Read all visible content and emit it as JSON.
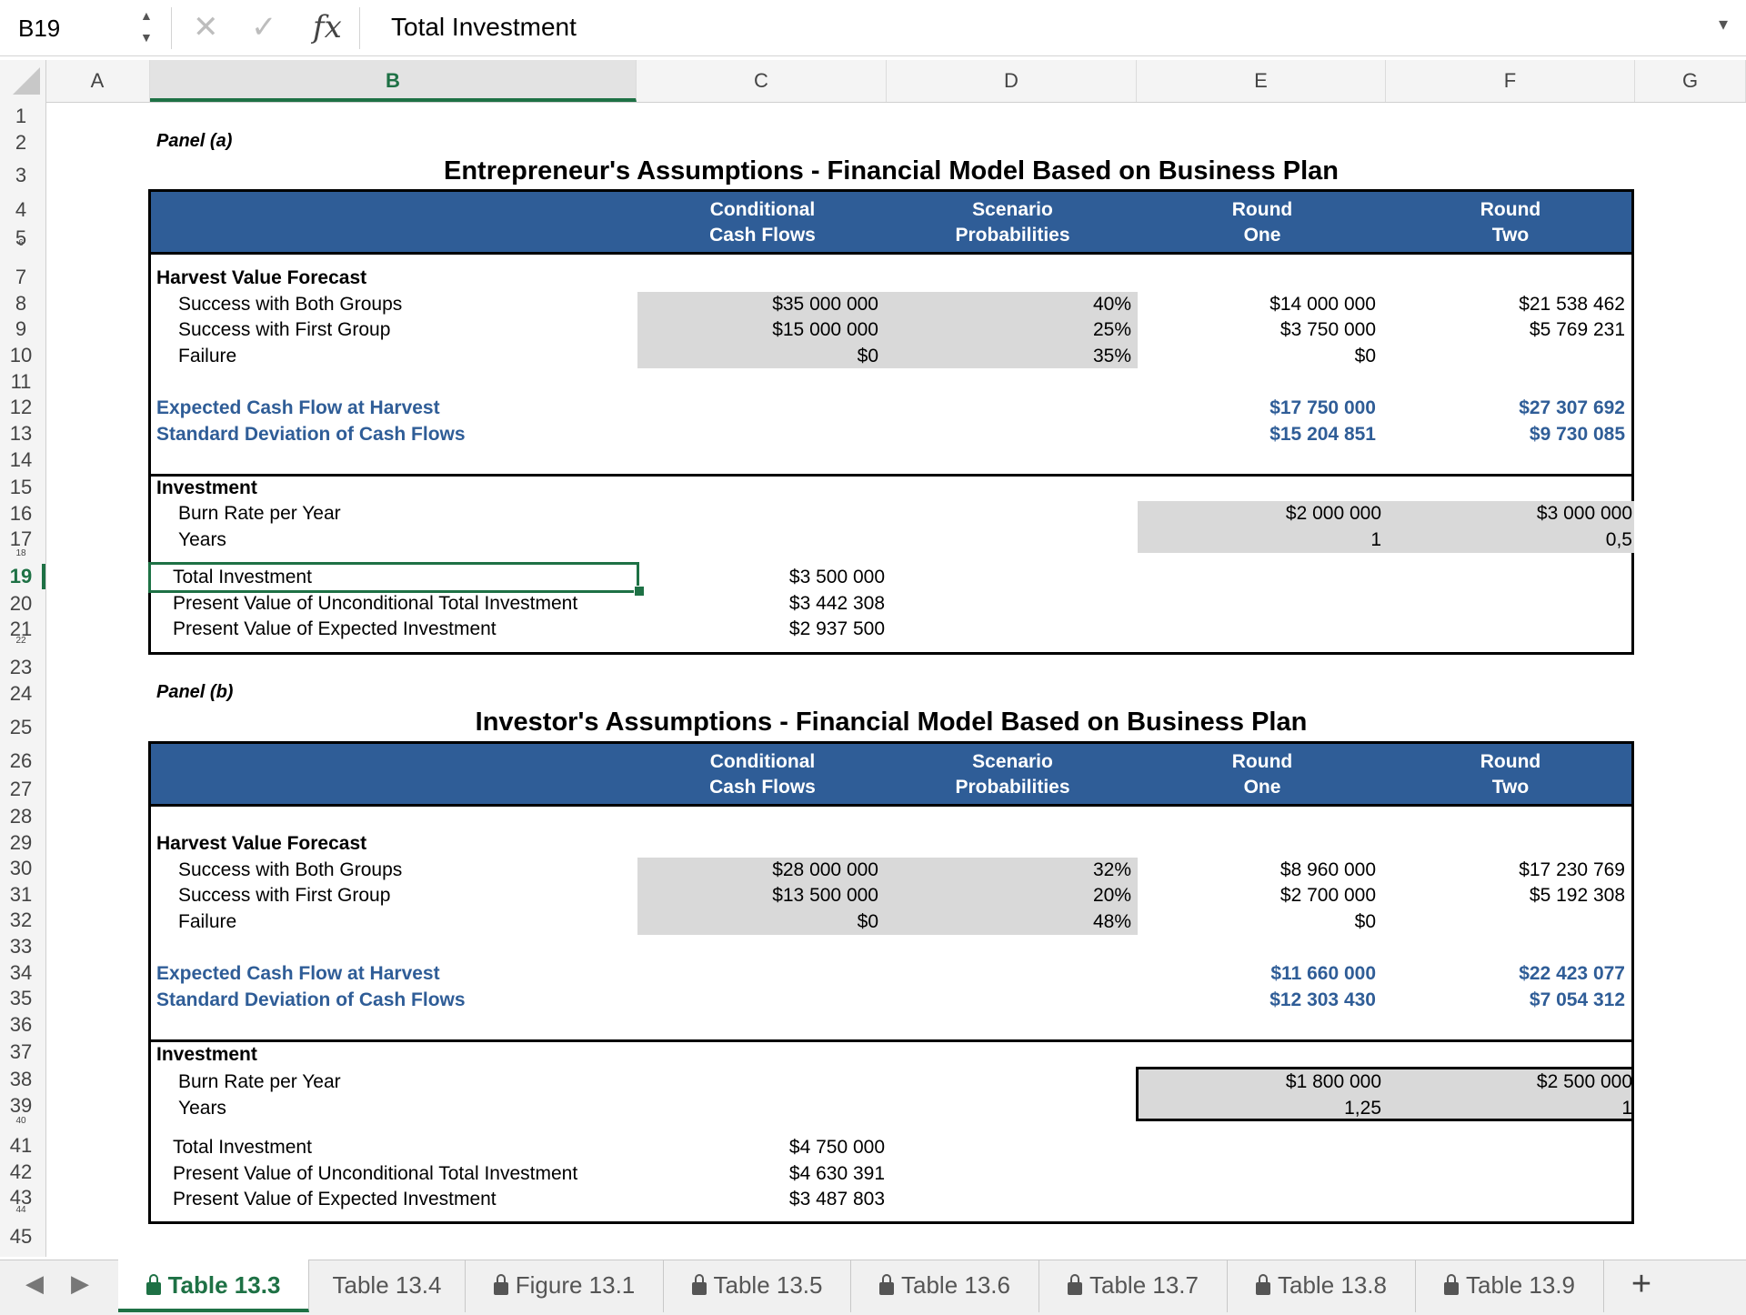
{
  "formula_bar": {
    "name_box": "B19",
    "cancel_icon": "✕",
    "enter_icon": "✓",
    "fx_label": "fx",
    "formula": "Total Investment",
    "dropdown_icon": "▾"
  },
  "columns": [
    "A",
    "B",
    "C",
    "D",
    "E",
    "F",
    "G"
  ],
  "selected_column": "B",
  "rows": [
    "1",
    "2",
    "3",
    "4",
    "5",
    "6",
    "7",
    "8",
    "9",
    "10",
    "11",
    "12",
    "13",
    "14",
    "15",
    "16",
    "17",
    "18",
    "19",
    "20",
    "21",
    "22",
    "23",
    "24",
    "25",
    "26",
    "27",
    "28",
    "29",
    "30",
    "31",
    "32",
    "33",
    "34",
    "35",
    "36",
    "37",
    "38",
    "39",
    "40",
    "41",
    "42",
    "43",
    "44",
    "45"
  ],
  "selected_row": "19",
  "panel_a": {
    "label": "Panel (a)",
    "title": "Entrepreneur's Assumptions - Financial Model Based on Business Plan",
    "headers": [
      {
        "l1": "Conditional",
        "l2": "Cash Flows"
      },
      {
        "l1": "Scenario",
        "l2": "Probabilities"
      },
      {
        "l1": "Round",
        "l2": "One"
      },
      {
        "l1": "Round",
        "l2": "Two"
      }
    ],
    "forecast_title": "Harvest Value Forecast",
    "scenarios": [
      {
        "label": "Success with Both Groups",
        "cash": "$35 000 000",
        "prob": "40%",
        "r1": "$14 000 000",
        "r2": "$21 538 462"
      },
      {
        "label": "Success with First Group",
        "cash": "$15 000 000",
        "prob": "25%",
        "r1": "$3 750 000",
        "r2": "$5 769 231"
      },
      {
        "label": "Failure",
        "cash": "$0",
        "prob": "35%",
        "r1": "$0",
        "r2": ""
      }
    ],
    "expected_label": "Expected Cash Flow at Harvest",
    "expected_r1": "$17 750 000",
    "expected_r2": "$27 307 692",
    "stdev_label": "Standard Deviation of Cash Flows",
    "stdev_r1": "$15 204 851",
    "stdev_r2": "$9 730 085",
    "investment_title": "Investment",
    "burn_label": "Burn Rate per Year",
    "burn_r1": "$2 000 000",
    "burn_r2": "$3 000 000",
    "years_label": "Years",
    "years_r1": "1",
    "years_r2": "0,5",
    "total_label": "Total Investment",
    "total_value": "$3 500 000",
    "pv_uncond_label": "Present Value of Unconditional Total Investment",
    "pv_uncond_value": "$3 442 308",
    "pv_expected_label": "Present Value of Expected Investment",
    "pv_expected_value": "$2 937 500"
  },
  "panel_b": {
    "label": "Panel (b)",
    "title": "Investor's Assumptions - Financial Model Based on Business Plan",
    "headers": [
      {
        "l1": "Conditional",
        "l2": "Cash Flows"
      },
      {
        "l1": "Scenario",
        "l2": "Probabilities"
      },
      {
        "l1": "Round",
        "l2": "One"
      },
      {
        "l1": "Round",
        "l2": "Two"
      }
    ],
    "forecast_title": "Harvest Value Forecast",
    "scenarios": [
      {
        "label": "Success with Both Groups",
        "cash": "$28 000 000",
        "prob": "32%",
        "r1": "$8 960 000",
        "r2": "$17 230 769"
      },
      {
        "label": "Success with First Group",
        "cash": "$13 500 000",
        "prob": "20%",
        "r1": "$2 700 000",
        "r2": "$5 192 308"
      },
      {
        "label": "Failure",
        "cash": "$0",
        "prob": "48%",
        "r1": "$0",
        "r2": ""
      }
    ],
    "expected_label": "Expected Cash Flow at Harvest",
    "expected_r1": "$11 660 000",
    "expected_r2": "$22 423 077",
    "stdev_label": "Standard Deviation of Cash Flows",
    "stdev_r1": "$12 303 430",
    "stdev_r2": "$7 054 312",
    "investment_title": "Investment",
    "burn_label": "Burn Rate per Year",
    "burn_r1": "$1 800 000",
    "burn_r2": "$2 500 000",
    "years_label": "Years",
    "years_r1": "1,25",
    "years_r2": "1",
    "total_label": "Total Investment",
    "total_value": "$4 750 000",
    "pv_uncond_label": "Present Value of Unconditional Total Investment",
    "pv_uncond_value": "$4 630 391",
    "pv_expected_label": "Present Value of Expected Investment",
    "pv_expected_value": "$3 487 803"
  },
  "sheet_tabs": [
    {
      "label": "Table 13.3",
      "locked": true,
      "active": true
    },
    {
      "label": "Table 13.4",
      "locked": false,
      "active": false
    },
    {
      "label": "Figure 13.1",
      "locked": true,
      "active": false
    },
    {
      "label": "Table 13.5",
      "locked": true,
      "active": false
    },
    {
      "label": "Table 13.6",
      "locked": true,
      "active": false
    },
    {
      "label": "Table 13.7",
      "locked": true,
      "active": false
    },
    {
      "label": "Table 13.8",
      "locked": true,
      "active": false
    },
    {
      "label": "Table 13.9",
      "locked": true,
      "active": false
    }
  ],
  "add_sheet": "+",
  "nav_prev": "◀",
  "nav_next": "▶",
  "colors": {
    "accent": "#1e7145",
    "header_band": "#2f5d97",
    "shaded": "#d9d9d9"
  }
}
